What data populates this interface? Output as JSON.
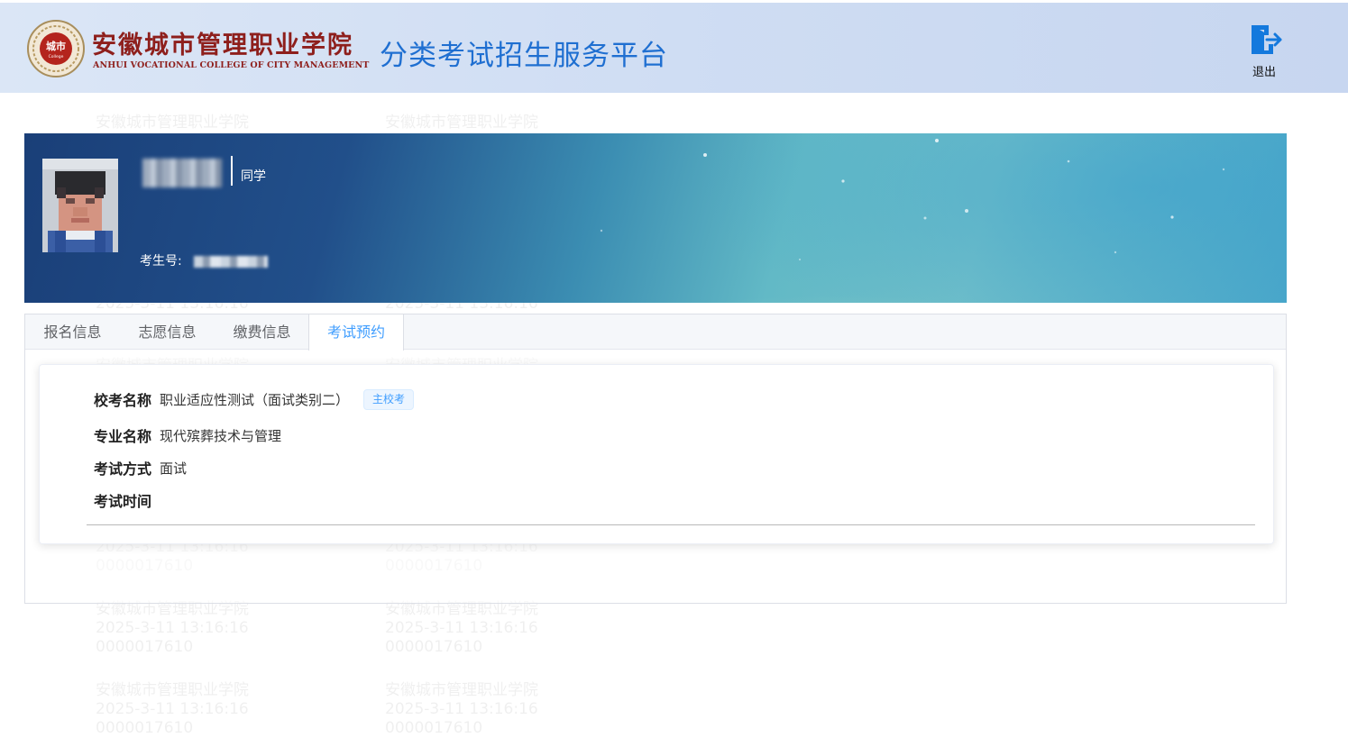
{
  "header": {
    "logo_seal_text": "城市",
    "logo_seal_sub": "College",
    "logo_cn": "安徽城市管理职业学院",
    "logo_en": "ANHUI VOCATIONAL COLLEGE OF CITY MANAGEMENT",
    "platform_title": "分类考试招生服务平台",
    "logout_label": "退出"
  },
  "profile": {
    "suffix": "同学",
    "exam_number_label": "考生号:"
  },
  "tabs": [
    {
      "label": "报名信息",
      "active": false
    },
    {
      "label": "志愿信息",
      "active": false
    },
    {
      "label": "缴费信息",
      "active": false
    },
    {
      "label": "考试预约",
      "active": true
    }
  ],
  "exam": {
    "school_exam_label": "校考名称",
    "school_exam_value": "职业适应性测试（面试类别二）",
    "main_campus_tag": "主校考",
    "major_label": "专业名称",
    "major_value": "现代殡葬技术与管理",
    "method_label": "考试方式",
    "method_value": "面试",
    "time_label": "考试时间",
    "time_value": ""
  },
  "watermark": {
    "line1": "安徽城市管理职业学院",
    "line2": "2025-3-11 13:16:16",
    "line3": "0000017610"
  },
  "colors": {
    "accent": "#409eff",
    "title_blue": "#1f6fd1",
    "brand_red": "#8e1f1c",
    "header_bg": "#cfddf3"
  },
  "icons": {
    "logout": "logout-icon",
    "seal": "college-seal-icon"
  }
}
